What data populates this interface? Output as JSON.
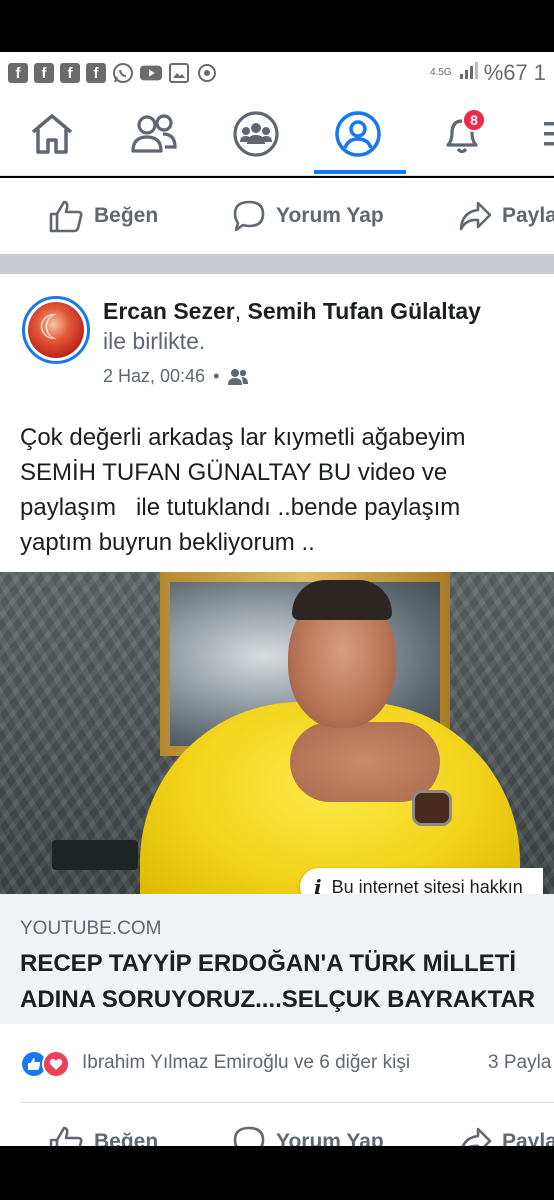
{
  "status_bar": {
    "network": "4.5G",
    "battery_percent": "%67",
    "time_partial": "1",
    "notification_icons": [
      "facebook-icon",
      "facebook-icon",
      "facebook-icon",
      "facebook-icon",
      "whatsapp-icon",
      "youtube-icon",
      "gallery-icon",
      "sync-icon"
    ]
  },
  "nav": {
    "items": [
      "home-icon",
      "friends-icon",
      "groups-icon",
      "profile-icon",
      "notifications-icon",
      "menu-icon"
    ],
    "active": "profile-icon",
    "notification_badge": "8",
    "accent_color": "#1877f2"
  },
  "top_actions": {
    "like": "Beğen",
    "comment": "Yorum Yap",
    "share": "Payla"
  },
  "post": {
    "author": "Ercan Sezer",
    "separator": ", ",
    "tagged": "Semih Tufan Gülaltay",
    "with_text": "ile birlikte.",
    "date": "2 Haz, 00:46",
    "dot": "•",
    "privacy_icon": "friends-icon",
    "text": "Çok değerli arkadaş lar kıymetli ağabeyim\nSEMİH TUFAN GÜNALTAY BU video ve\npaylaşım   ile tutuklandı ..bende paylaşım\nyaptım buyrun bekliyorum ..",
    "video_info": "Bu internet sitesi hakkın",
    "link_domain": "YOUTUBE.COM",
    "link_title": "RECEP TAYYİP ERDOĞAN'A TÜRK MİLLETİ\nADINA SORUYORUZ....SELÇUK BAYRAKTAR",
    "reactions_text": "Ibrahim Yılmaz Emiroğlu ve 6 diğer kişi",
    "shares": "3 Payla"
  },
  "bottom_actions": {
    "like": "Beğen",
    "comment": "Yorum Yap",
    "share": "Payla"
  }
}
